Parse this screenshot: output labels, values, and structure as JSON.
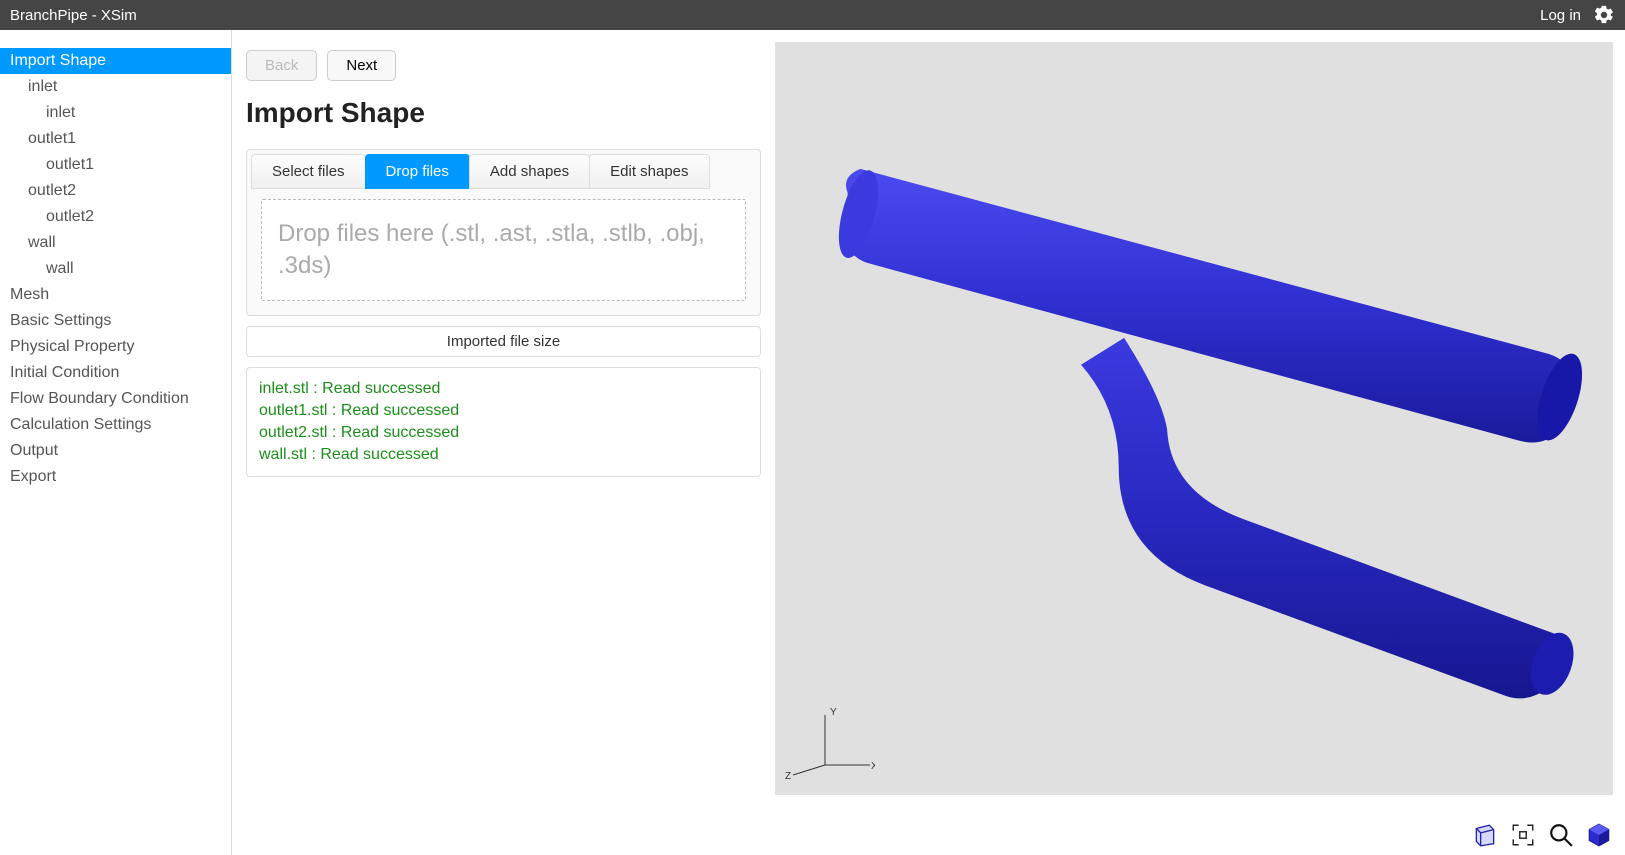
{
  "titlebar": {
    "title": "BranchPipe - XSim",
    "login": "Log in"
  },
  "sidebar": {
    "items": [
      {
        "label": "Import Shape",
        "level": 0,
        "active": true
      },
      {
        "label": "inlet",
        "level": 1
      },
      {
        "label": "inlet",
        "level": 2
      },
      {
        "label": "outlet1",
        "level": 1
      },
      {
        "label": "outlet1",
        "level": 2
      },
      {
        "label": "outlet2",
        "level": 1
      },
      {
        "label": "outlet2",
        "level": 2
      },
      {
        "label": "wall",
        "level": 1
      },
      {
        "label": "wall",
        "level": 2
      },
      {
        "label": "Mesh",
        "level": 0
      },
      {
        "label": "Basic Settings",
        "level": 0
      },
      {
        "label": "Physical Property",
        "level": 0
      },
      {
        "label": "Initial Condition",
        "level": 0
      },
      {
        "label": "Flow Boundary Condition",
        "level": 0
      },
      {
        "label": "Calculation Settings",
        "level": 0
      },
      {
        "label": "Output",
        "level": 0
      },
      {
        "label": "Export",
        "level": 0
      }
    ]
  },
  "nav": {
    "back": "Back",
    "next": "Next"
  },
  "page": {
    "heading": "Import Shape"
  },
  "tabs": [
    {
      "label": "Select files",
      "active": false
    },
    {
      "label": "Drop files",
      "active": true
    },
    {
      "label": "Add shapes",
      "active": false
    },
    {
      "label": "Edit shapes",
      "active": false
    }
  ],
  "dropzone": {
    "text": "Drop files here (.stl, .ast, .stla, .stlb, .obj, .3ds)"
  },
  "filesize": {
    "label": "Imported file size"
  },
  "log": {
    "lines": [
      "inlet.stl : Read successed",
      "outlet1.stl : Read successed",
      "outlet2.stl : Read successed",
      "wall.stl : Read successed"
    ]
  },
  "axes": {
    "x": "X",
    "y": "Y",
    "z": "Z"
  },
  "colors": {
    "accent": "#0099ff",
    "pipe": "#2424c2"
  }
}
